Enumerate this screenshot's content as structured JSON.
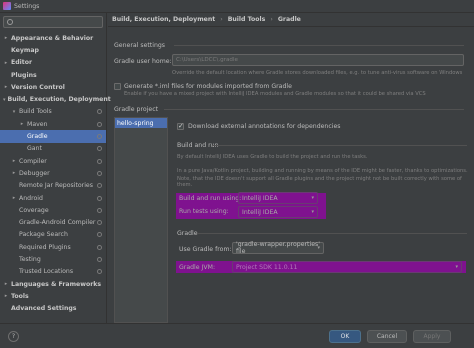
{
  "window": {
    "title": "Settings"
  },
  "search": {
    "placeholder": ""
  },
  "sidebar": {
    "items": [
      {
        "label": "Appearance & Behavior",
        "arrow": "▸",
        "bold": true
      },
      {
        "label": "Keymap",
        "arrow": "",
        "bold": true
      },
      {
        "label": "Editor",
        "arrow": "▸",
        "bold": true
      },
      {
        "label": "Plugins",
        "arrow": "",
        "bold": true
      },
      {
        "label": "Version Control",
        "arrow": "▸",
        "bold": true
      },
      {
        "label": "Build, Execution, Deployment",
        "arrow": "▾",
        "bold": true
      },
      {
        "label": "Build Tools",
        "arrow": "▾",
        "bold": false
      },
      {
        "label": "Maven",
        "arrow": "▸",
        "bold": false
      },
      {
        "label": "Gradle",
        "arrow": "",
        "bold": false
      },
      {
        "label": "Gant",
        "arrow": "",
        "bold": false
      },
      {
        "label": "Compiler",
        "arrow": "▸",
        "bold": false
      },
      {
        "label": "Debugger",
        "arrow": "▸",
        "bold": false
      },
      {
        "label": "Remote Jar Repositories",
        "arrow": "",
        "bold": false
      },
      {
        "label": "Android",
        "arrow": "▸",
        "bold": false
      },
      {
        "label": "Coverage",
        "arrow": "",
        "bold": false
      },
      {
        "label": "Gradle-Android Compiler",
        "arrow": "",
        "bold": false
      },
      {
        "label": "Package Search",
        "arrow": "",
        "bold": false
      },
      {
        "label": "Required Plugins",
        "arrow": "",
        "bold": false
      },
      {
        "label": "Testing",
        "arrow": "",
        "bold": false
      },
      {
        "label": "Trusted Locations",
        "arrow": "",
        "bold": false
      },
      {
        "label": "Languages & Frameworks",
        "arrow": "▸",
        "bold": true
      },
      {
        "label": "Tools",
        "arrow": "▸",
        "bold": true
      },
      {
        "label": "Advanced Settings",
        "arrow": "",
        "bold": true
      }
    ]
  },
  "breadcrumb": {
    "items": [
      "Build, Execution, Deployment",
      "Build Tools",
      "Gradle"
    ],
    "separator": "›"
  },
  "general": {
    "heading": "General settings",
    "user_home_label": "Gradle user home:",
    "user_home_value": "C:\\Users\\LDCC\\.gradle",
    "user_home_hint": "Override the default location where Gradle stores downloaded files, e.g. to tune anti-virus software on Windows",
    "iml_label": "Generate *.iml files for modules imported from Gradle",
    "iml_hint": "Enable if you have a mixed project with IntelliJ IDEA modules and Gradle modules so that it could be shared via VCS"
  },
  "project": {
    "heading": "Gradle project",
    "list": [
      "hello-spring"
    ],
    "annotations_label": "Download external annotations for dependencies",
    "build_run_heading": "Build and run",
    "build_run_hint1": "By default IntelliJ IDEA uses Gradle to build the project and run the tasks.",
    "build_run_hint2": "In a pure Java/Kotlin project, building and running by means of the IDE might be faster, thanks to optimizations.",
    "build_run_hint3": "Note, that the IDE doesn't support all Gradle plugins and the project might not be built correctly with some of them.",
    "build_and_run_label": "Build and run using:",
    "build_and_run_value": "IntelliJ IDEA",
    "run_tests_label": "Run tests using:",
    "run_tests_value": "IntelliJ IDEA",
    "gradle_heading": "Gradle",
    "use_gradle_label": "Use Gradle from:",
    "use_gradle_value": "'gradle-wrapper.properties' file",
    "gradle_jvm_label": "Gradle JVM:",
    "gradle_jvm_value": "Project SDK 11.0.11"
  },
  "footer": {
    "help": "?",
    "ok": "OK",
    "cancel": "Cancel",
    "apply": "Apply"
  },
  "colors": {
    "selection": "#4b6eaf",
    "highlight": "#8b0a9e",
    "background": "#3c3f41"
  }
}
